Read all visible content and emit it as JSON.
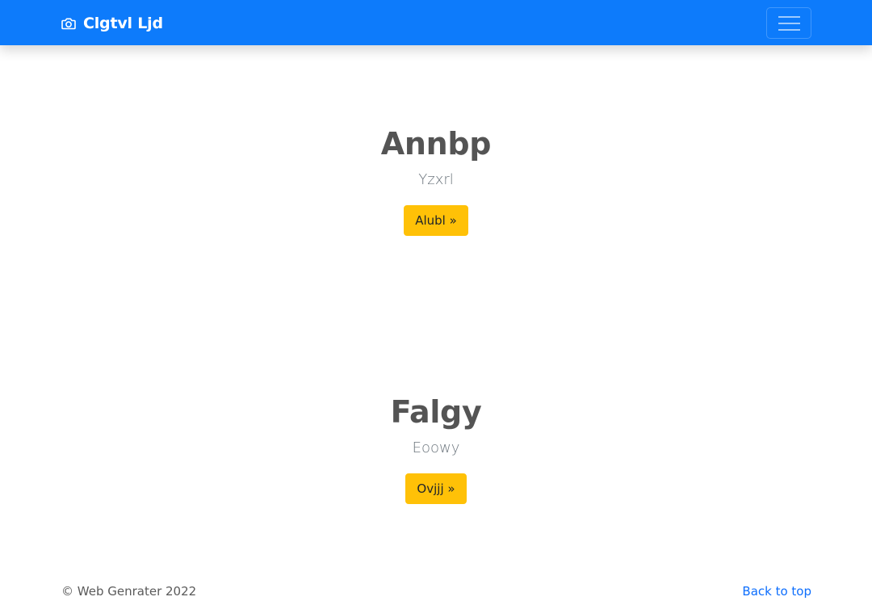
{
  "navbar": {
    "brand_icon": "camera-icon",
    "brand_text": "Clgtvl Ljd",
    "toggler_icon": "hamburger-menu-icon",
    "background": "#0d7bfb"
  },
  "sections": [
    {
      "title": "Annbp",
      "subtitle": "Yzxrl",
      "button_label": "Alubl »"
    },
    {
      "title": "Falgy",
      "subtitle": "Eoowy",
      "button_label": "Ovjjj »"
    }
  ],
  "footer": {
    "copyright": "© Web Genrater 2022",
    "back_to_top": "Back to top"
  },
  "colors": {
    "accent_button": "#ffc107",
    "link": "#0d6efd"
  }
}
